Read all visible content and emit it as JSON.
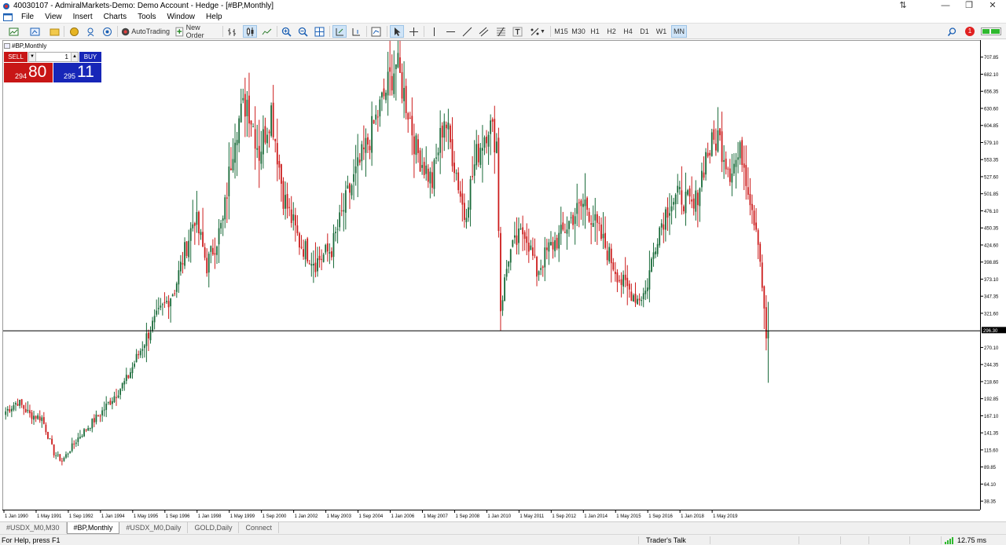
{
  "window": {
    "title": "40030107 - AdmiralMarkets-Demo: Demo Account - Hedge - [#BP,Monthly]",
    "controls": [
      "―",
      "❐",
      "✕"
    ]
  },
  "menu": {
    "items": [
      "File",
      "View",
      "Insert",
      "Charts",
      "Tools",
      "Window",
      "Help"
    ]
  },
  "toolbar": {
    "autotrading_label": "AutoTrading",
    "new_order_label": "New Order",
    "timeframes": [
      "M15",
      "M30",
      "H1",
      "H2",
      "H4",
      "D1",
      "W1",
      "MN"
    ],
    "active_timeframe": "MN",
    "alert_count": "1"
  },
  "chart": {
    "label": "#BP,Monthly",
    "current_price_label": "296.30",
    "colors": {
      "bull": "#1a6b3a",
      "bear": "#cc1c1c",
      "current_line": "#000000"
    }
  },
  "trade_panel": {
    "sell_label": "SELL",
    "buy_label": "BUY",
    "lot_value": "1",
    "sell_price_small": "294",
    "sell_price_big": "80",
    "buy_price_small": "295",
    "buy_price_big": "11"
  },
  "tabs": [
    "#USDX_M0,M30",
    "#BP,Monthly",
    "#USDX_M0,Daily",
    "GOLD,Daily",
    "Connect"
  ],
  "active_tab": "#BP,Monthly",
  "status": {
    "help_text": "For Help, press F1",
    "community": "Trader's Talk",
    "ping": "12.75 ms"
  },
  "chart_data": {
    "type": "candlestick",
    "title": "#BP,Monthly",
    "y_ticks": [
      "707.85",
      "682.10",
      "656.35",
      "630.60",
      "604.85",
      "579.10",
      "553.35",
      "527.60",
      "501.85",
      "476.10",
      "450.35",
      "424.60",
      "398.85",
      "373.10",
      "347.35",
      "321.60",
      "296.30",
      "270.10",
      "244.35",
      "218.60",
      "192.85",
      "167.10",
      "141.35",
      "115.60",
      "89.85",
      "64.10",
      "38.35"
    ],
    "x_ticks": [
      "1 Jan 1990",
      "1 May 1991",
      "1 Sep 1992",
      "1 Jan 1994",
      "1 May 1995",
      "1 Sep 1996",
      "1 Jan 1998",
      "1 May 1999",
      "1 Sep 2000",
      "1 Jan 2002",
      "1 May 2003",
      "1 Sep 2004",
      "1 Jan 2006",
      "1 May 2007",
      "1 Sep 2008",
      "1 Jan 2010",
      "1 May 2011",
      "1 Sep 2012",
      "1 Jan 2014",
      "1 May 2015",
      "1 Sep 2016",
      "1 Jan 2018",
      "1 May 2019"
    ],
    "ylim": [
      25.5,
      733.6
    ],
    "current_price": 296.3,
    "keypoints": [
      [
        0,
        175
      ],
      [
        6,
        190
      ],
      [
        12,
        170
      ],
      [
        18,
        165
      ],
      [
        24,
        112
      ],
      [
        28,
        100
      ],
      [
        36,
        135
      ],
      [
        48,
        175
      ],
      [
        60,
        222
      ],
      [
        72,
        300
      ],
      [
        84,
        360
      ],
      [
        94,
        470
      ],
      [
        100,
        395
      ],
      [
        108,
        460
      ],
      [
        114,
        600
      ],
      [
        120,
        645
      ],
      [
        126,
        565
      ],
      [
        132,
        630
      ],
      [
        138,
        500
      ],
      [
        146,
        430
      ],
      [
        154,
        400
      ],
      [
        162,
        420
      ],
      [
        170,
        500
      ],
      [
        180,
        580
      ],
      [
        188,
        650
      ],
      [
        194,
        700
      ],
      [
        200,
        630
      ],
      [
        204,
        570
      ],
      [
        212,
        520
      ],
      [
        218,
        620
      ],
      [
        224,
        535
      ],
      [
        228,
        470
      ],
      [
        234,
        560
      ],
      [
        240,
        610
      ],
      [
        244,
        580
      ],
      [
        246,
        330
      ],
      [
        250,
        410
      ],
      [
        258,
        450
      ],
      [
        264,
        385
      ],
      [
        270,
        420
      ],
      [
        276,
        440
      ],
      [
        282,
        470
      ],
      [
        288,
        490
      ],
      [
        294,
        450
      ],
      [
        300,
        410
      ],
      [
        306,
        370
      ],
      [
        314,
        345
      ],
      [
        318,
        355
      ],
      [
        324,
        445
      ],
      [
        330,
        490
      ],
      [
        336,
        500
      ],
      [
        342,
        478
      ],
      [
        348,
        560
      ],
      [
        354,
        590
      ],
      [
        360,
        540
      ],
      [
        366,
        565
      ],
      [
        370,
        500
      ],
      [
        374,
        440
      ],
      [
        377,
        330
      ],
      [
        378,
        285
      ],
      [
        379,
        296
      ]
    ]
  }
}
